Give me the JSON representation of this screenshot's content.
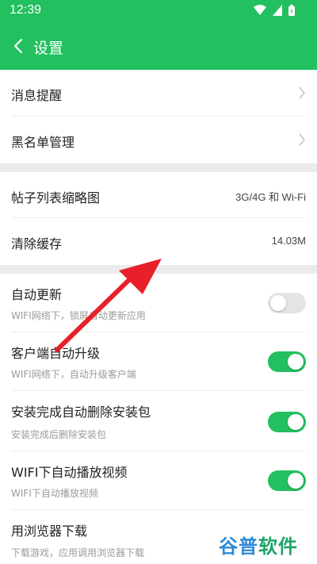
{
  "status_bar": {
    "time": "12:39"
  },
  "header": {
    "title": "设置"
  },
  "group1": [
    {
      "label": "消息提醒"
    },
    {
      "label": "黑名单管理"
    }
  ],
  "group2": [
    {
      "label": "帖子列表缩略图",
      "value": "3G/4G 和 Wi-Fi"
    },
    {
      "label": "清除缓存",
      "value": "14.03M"
    }
  ],
  "group3": [
    {
      "label": "自动更新",
      "sub": "WIFI网络下，锁屏自动更新应用",
      "enabled": false
    },
    {
      "label": "客户端自动升级",
      "sub": "WIFI网络下，自动升级客户端",
      "enabled": true
    },
    {
      "label": "安装完成自动删除安装包",
      "sub": "安装完成后删除安装包",
      "enabled": true
    },
    {
      "label": "WIFI下自动播放视频",
      "sub": "WIFI下自动播放视频",
      "enabled": true
    },
    {
      "label": "用浏览器下载",
      "sub": "下载游戏，应用调用浏览器下载"
    }
  ],
  "watermark": {
    "part1": "谷普",
    "part2": "软件园"
  },
  "colors": {
    "accent": "#22c05f",
    "annotation_arrow": "#e8202a",
    "background": "#ebebeb"
  }
}
